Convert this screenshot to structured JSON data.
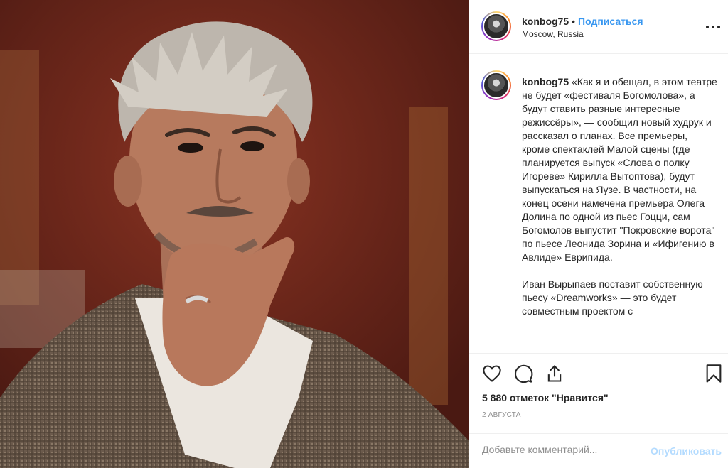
{
  "post": {
    "username": "konbog75",
    "separator": "•",
    "follow_label": "Подписаться",
    "location": "Moscow, Russia",
    "photo_description": "Portrait photo of a man with spiky grey hair resting chin on his hand"
  },
  "caption": {
    "username": "konbog75",
    "paragraph1": "«Как я и обещал, в этом театре не будет «фестиваля Богомолова», а будут ставить разные интересные режиссёры», — сообщил новый худрук и рассказал о планах. Все премьеры, кроме спектаклей Малой сцены (где планируется выпуск «Слова о полку Игореве» Кирилла Вытоптова), будут выпускаться на Яузе. В частности, на конец осени намечена премьера Олега Долина по одной из пьес Гоцци, сам Богомолов выпустит \"Покровские ворота\" по пьесе Леонида Зорина и «Ифигению в Авлиде» Еврипида.",
    "paragraph2": "Иван Вырыпаев поставит собственную пьесу «Dreamworks» — это будет совместным проектом с"
  },
  "actions": {
    "likes": "5 880 отметок \"Нравится\"",
    "date": "2 августа",
    "comment_placeholder": "Добавьте комментарий...",
    "publish_label": "Опубликовать"
  },
  "icons": [
    "heart-icon",
    "comment-icon",
    "share-icon",
    "bookmark-icon",
    "more-options-icon"
  ]
}
